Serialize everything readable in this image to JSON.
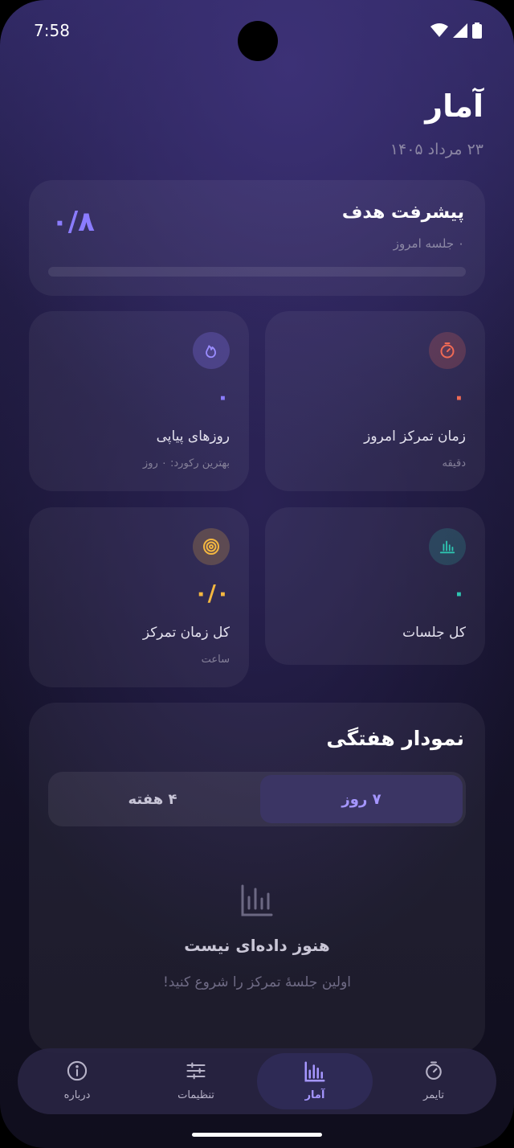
{
  "status_bar": {
    "time": "7:58"
  },
  "header": {
    "title": "آمار",
    "date": "۲۳ مرداد ۱۴۰۵"
  },
  "goal": {
    "title": "پیشرفت هدف",
    "subtitle": "۰ جلسه امروز",
    "value": "۰/۸",
    "progress": 0
  },
  "stats": {
    "focus_today": {
      "value": "۰",
      "label": "زمان تمرکز امروز",
      "sub": "دقیقه",
      "icon": "stopwatch-icon",
      "color": "#ef6a55"
    },
    "streak": {
      "value": "۰",
      "label": "روزهای پیاپی",
      "sub": "بهترین رکورد: ۰ روز",
      "icon": "flame-icon",
      "color": "#8b7cff"
    },
    "total_sessions": {
      "value": "۰",
      "label": "کل جلسات",
      "icon": "bar-chart-icon",
      "color": "#2ec4b0"
    },
    "total_focus": {
      "value": "۰/۰",
      "label": "کل زمان تمرکز",
      "sub": "ساعت",
      "icon": "target-icon",
      "color": "#f4b740"
    }
  },
  "weekly_chart": {
    "title": "نمودار هفتگی",
    "tabs": [
      {
        "label": "۷ روز",
        "active": true
      },
      {
        "label": "۴ هفته",
        "active": false
      }
    ],
    "empty_title": "هنوز داده‌ای نیست",
    "empty_subtitle": "اولین جلسهٔ تمرکز را شروع کنید!"
  },
  "nav": [
    {
      "label": "تایمر",
      "icon": "timer-icon",
      "active": false
    },
    {
      "label": "آمار",
      "icon": "stats-icon",
      "active": true
    },
    {
      "label": "تنظیمات",
      "icon": "sliders-icon",
      "active": false
    },
    {
      "label": "درباره",
      "icon": "info-icon",
      "active": false
    }
  ]
}
